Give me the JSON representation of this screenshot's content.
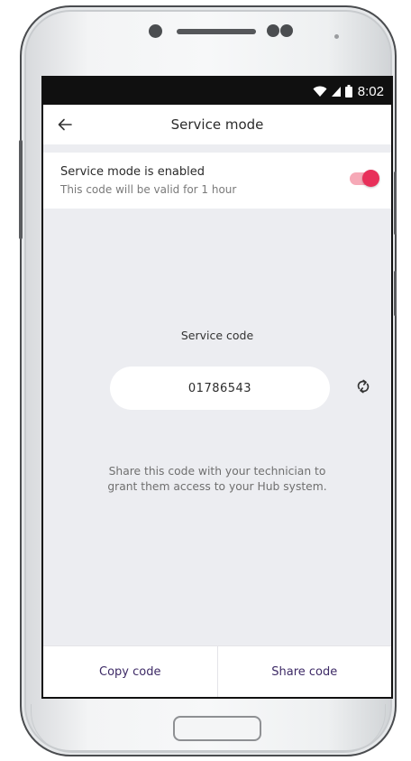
{
  "status_bar": {
    "time": "8:02",
    "icons": [
      "wifi-icon",
      "signal-icon",
      "battery-icon"
    ]
  },
  "app_bar": {
    "back_icon": "arrow-left-icon",
    "title": "Service mode"
  },
  "service_toggle": {
    "title": "Service mode is enabled",
    "subtitle": "This code will be valid for 1 hour",
    "enabled": true,
    "accent_color": "#e8305a"
  },
  "service_code": {
    "label": "Service code",
    "value": "01786543",
    "refresh_icon": "refresh-icon"
  },
  "help": {
    "line1": "Share this code with your technician to",
    "line2": "grant them access to your Hub system."
  },
  "actions": {
    "copy_label": "Copy code",
    "share_label": "Share code"
  }
}
